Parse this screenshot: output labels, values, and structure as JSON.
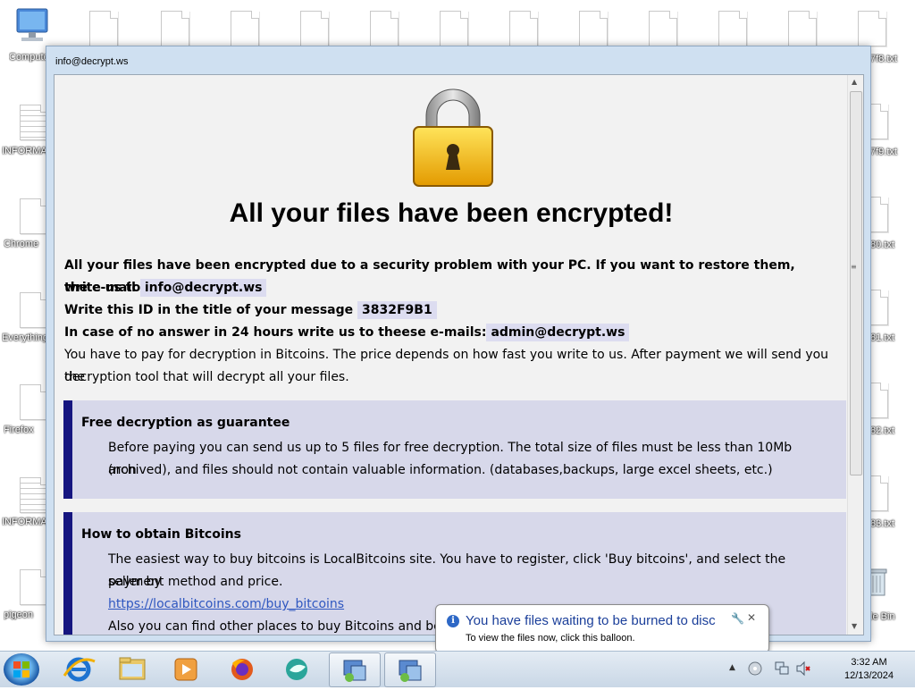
{
  "desktop": {
    "left_icons": [
      "Computer",
      "INFORMATION how...",
      "Chrome",
      "Everything",
      "Firefox",
      "INFORMATION how...",
      "pigeon"
    ],
    "right_icons": [
      "p",
      "p",
      "p",
      "p",
      "p",
      "p",
      "p",
      "p",
      "p",
      "Recycle Bin"
    ],
    "right_labels_visible": [
      "7f8.txt",
      "7f9.txt",
      "80.txt",
      "81.txt",
      "82.txt",
      "83.txt",
      "le Bin"
    ]
  },
  "window": {
    "title": "info@decrypt.ws",
    "headline": "All your files have been encrypted!",
    "para1": "All your files have been encrypted due to a security problem with your PC. If you want to restore them, write us to",
    "email_prefix": "the e-mail",
    "email": "info@decrypt.ws",
    "id_label": "Write this ID in the title of your message",
    "id_value": "3832F9B1",
    "backup_label": "In case of no answer in 24 hours write us to theese e-mails:",
    "backup_email": "admin@decrypt.ws",
    "pay_line1": "You have to pay for decryption in Bitcoins. The price depends on how fast you write to us. After payment we will send you the",
    "pay_line2": "decryption tool that will decrypt all your files.",
    "box1_title": "Free decryption as guarantee",
    "box1_line1": "Before paying you can send us up to 5 files for free decryption. The total size of files must be less than 10Mb (non",
    "box1_line2": "archived), and files should not contain valuable information. (databases,backups, large excel sheets, etc.)",
    "box2_title": "How to obtain Bitcoins",
    "box2_line1": "The easiest way to buy bitcoins is LocalBitcoins site. You have to register, click 'Buy bitcoins', and select the seller by",
    "box2_line2": "payment method and price.",
    "box2_link": "https://localbitcoins.com/buy_bitcoins",
    "box2_line3": "Also you can find other places to buy Bitcoins and beginn"
  },
  "balloon": {
    "title": "You have files waiting to be burned to disc",
    "text": "To view the files now, click this balloon."
  },
  "taskbar": {
    "time": "3:32 AM",
    "date": "12/13/2024",
    "pinned": [
      "internet-explorer",
      "file-explorer",
      "media-player",
      "firefox",
      "browser-app",
      "task-1",
      "task-2"
    ]
  },
  "colors": {
    "accent_bar": "#161680",
    "box_bg": "#d7d8ea",
    "highlight": "#dcdcf0",
    "link": "#2f57c0",
    "balloon_title": "#1b3f9a"
  }
}
